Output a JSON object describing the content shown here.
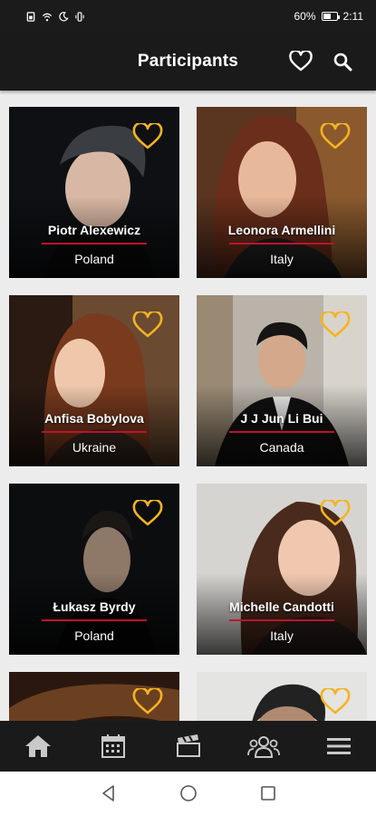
{
  "status_bar": {
    "battery_percent": "60%",
    "time": "2:11",
    "battery_level": 0.6
  },
  "app_bar": {
    "title": "Participants"
  },
  "participants": [
    {
      "name": "Piotr Alexewicz",
      "country": "Poland",
      "icon": "heart-outline-icon"
    },
    {
      "name": "Leonora Armellini",
      "country": "Italy",
      "icon": "heart-outline-icon"
    },
    {
      "name": "Anfisa Bobylova",
      "country": "Ukraine",
      "icon": "heart-outline-icon"
    },
    {
      "name": "J J Jun Li Bui",
      "country": "Canada",
      "icon": "heart-outline-icon"
    },
    {
      "name": "Łukasz Byrdy",
      "country": "Poland",
      "icon": "heart-outline-icon"
    },
    {
      "name": "Michelle Candotti",
      "country": "Italy",
      "icon": "heart-outline-icon"
    },
    {
      "name": "",
      "country": "",
      "icon": "heart-outline-icon"
    },
    {
      "name": "",
      "country": "",
      "icon": "heart-outline-icon"
    }
  ],
  "bottom_nav": [
    "home-icon",
    "calendar-icon",
    "clapperboard-icon",
    "group-icon",
    "menu-icon"
  ],
  "colors": {
    "accent": "#f5b321",
    "divider": "#c0122a",
    "bar": "#1a1a1a"
  }
}
